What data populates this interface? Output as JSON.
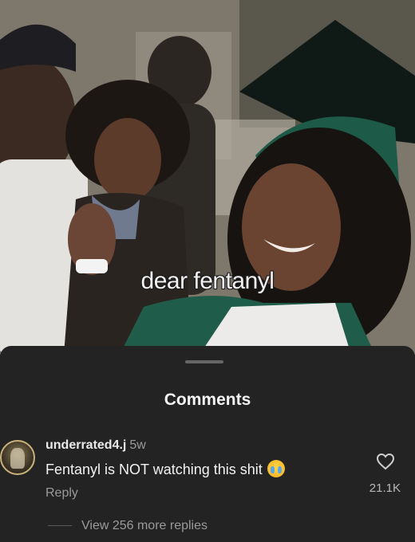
{
  "video": {
    "caption": "dear fentanyl"
  },
  "comments_sheet": {
    "title": "Comments",
    "comment": {
      "username": "underrated4.j",
      "age": "5w",
      "text": "Fentanyl is NOT watching this shit",
      "emoji": "crying-face-emoji",
      "reply_label": "Reply",
      "like_count": "21.1K",
      "like_icon": "heart-outline-icon"
    },
    "more_replies": "View 256 more replies"
  },
  "colors": {
    "sheet_bg": "#232323",
    "text_primary": "#f2f2f2",
    "text_secondary": "#9a9a9a"
  }
}
